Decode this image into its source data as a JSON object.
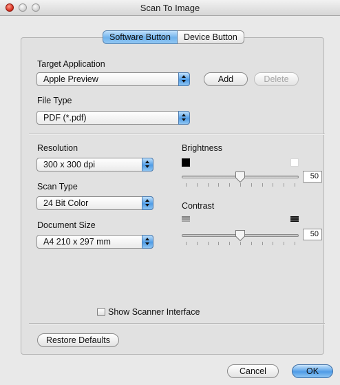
{
  "window": {
    "title": "Scan To Image",
    "traffic_lights": [
      "close-icon",
      "minimize-icon",
      "zoom-icon"
    ]
  },
  "tabs": [
    {
      "label": "Software Button",
      "selected": true
    },
    {
      "label": "Device Button",
      "selected": false
    }
  ],
  "target_application": {
    "label": "Target Application",
    "value": "Apple Preview",
    "add_label": "Add",
    "delete_label": "Delete",
    "delete_enabled": false
  },
  "file_type": {
    "label": "File Type",
    "value": "PDF (*.pdf)"
  },
  "resolution": {
    "label": "Resolution",
    "value": "300 x 300 dpi"
  },
  "scan_type": {
    "label": "Scan Type",
    "value": "24 Bit Color"
  },
  "document_size": {
    "label": "Document Size",
    "value": "A4  210 x 297 mm"
  },
  "brightness": {
    "label": "Brightness",
    "value": "50",
    "level": 50,
    "min_icon": "black-square-icon",
    "max_icon": "white-square-icon"
  },
  "contrast": {
    "label": "Contrast",
    "value": "50",
    "level": 50,
    "min_icon": "low-contrast-icon",
    "max_icon": "high-contrast-icon"
  },
  "show_scanner_interface": {
    "label": "Show Scanner Interface",
    "checked": false
  },
  "buttons": {
    "restore_defaults": "Restore Defaults",
    "cancel": "Cancel",
    "ok": "OK"
  },
  "colors": {
    "accent_blue": "#4f9ce6",
    "window_bg": "#e9e9e9"
  }
}
